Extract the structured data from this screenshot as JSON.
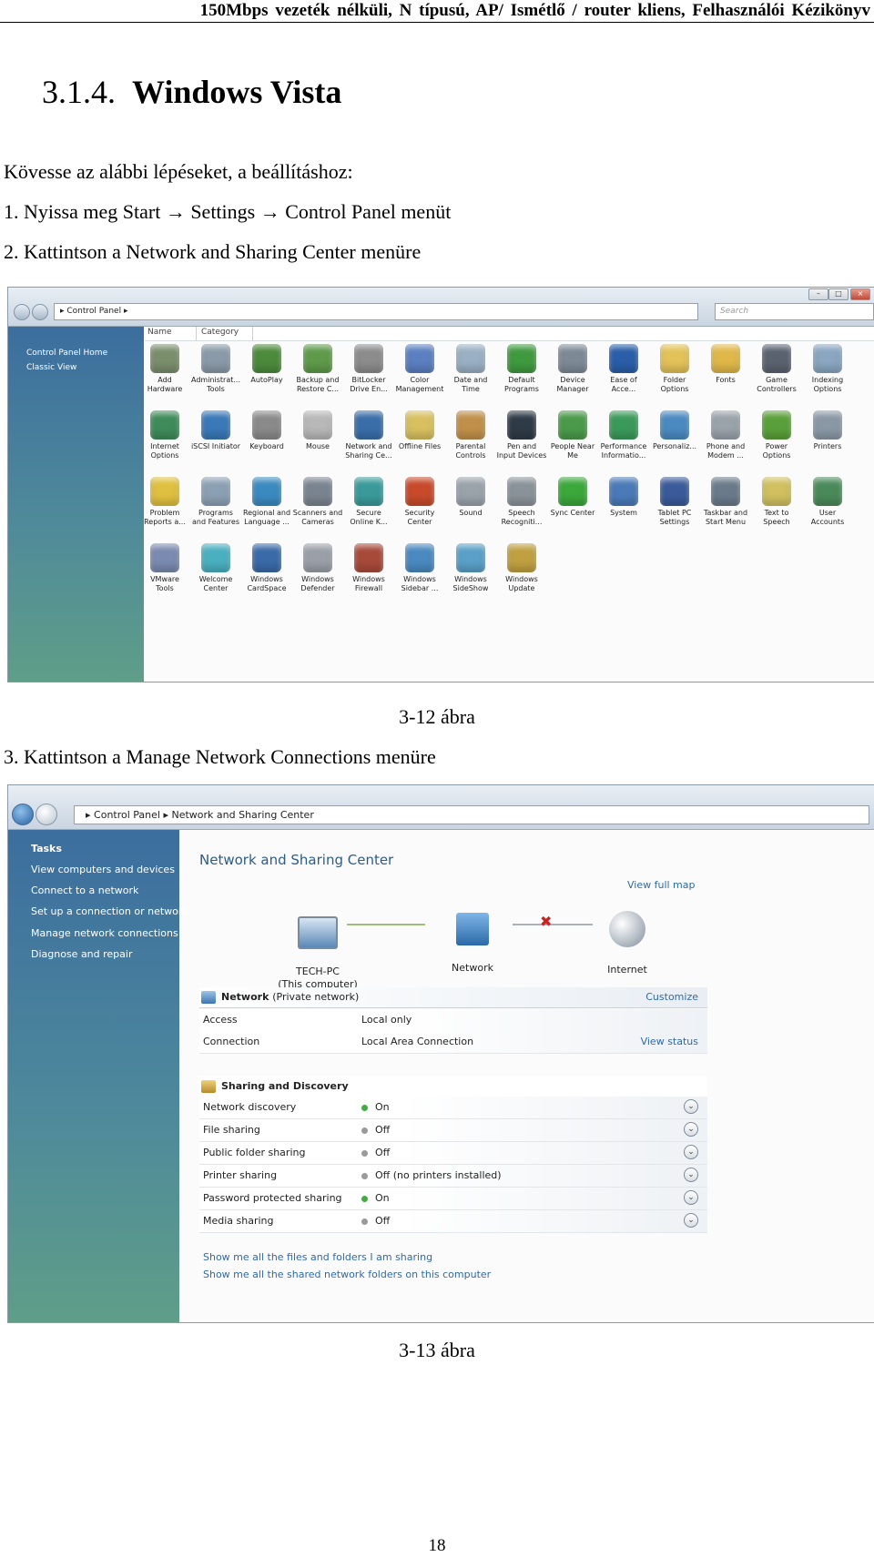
{
  "running_head": "150Mbps vezeték nélküli, N típusú, AP/ Ismétlő / router kliens, Felhasználói Kézikönyv",
  "section": {
    "number": "3.1.4.",
    "title": "Windows Vista"
  },
  "intro": "Kövesse az alábbi lépéseket, a beállításhoz:",
  "step1": "1. Nyissa meg Start → Settings → Control Panel menüt",
  "step2": "2. Kattintson a Network and Sharing Center menüre",
  "caption1": "3-12 ábra",
  "step3": "3. Kattintson a Manage Network Connections menüre",
  "caption2": "3-13 ábra",
  "page_number": "18",
  "control_panel": {
    "address": "Control Panel",
    "search_placeholder": "Search",
    "sidebar": [
      "Control Panel Home",
      "Classic View"
    ],
    "columns": [
      "Name",
      "Category"
    ],
    "items": [
      {
        "label": "Add\nHardware",
        "color": "#7a8e6c"
      },
      {
        "label": "Administrat...\nTools",
        "color": "#8a9aa8"
      },
      {
        "label": "AutoPlay",
        "color": "#4c8a3c"
      },
      {
        "label": "Backup and\nRestore C...",
        "color": "#5f9a4a"
      },
      {
        "label": "BitLocker\nDrive En...",
        "color": "#8c8c8c"
      },
      {
        "label": "Color\nManagement",
        "color": "#5b7fc0"
      },
      {
        "label": "Date and\nTime",
        "color": "#9ab0c4"
      },
      {
        "label": "Default\nPrograms",
        "color": "#3f9a3f"
      },
      {
        "label": "Device\nManager",
        "color": "#7d8a96"
      },
      {
        "label": "Ease of\nAcce...",
        "color": "#2a5ea8"
      },
      {
        "label": "Folder\nOptions",
        "color": "#e3c25a"
      },
      {
        "label": "Fonts",
        "color": "#e0b84a"
      },
      {
        "label": "Game\nControllers",
        "color": "#5a6270"
      },
      {
        "label": "Indexing\nOptions",
        "color": "#8aa6c0"
      },
      {
        "label": "Internet\nOptions",
        "color": "#3f8c5a"
      },
      {
        "label": "iSCSI Initiator",
        "color": "#3a78b8"
      },
      {
        "label": "Keyboard",
        "color": "#8a8a8a"
      },
      {
        "label": "Mouse",
        "color": "#b8b8b8"
      },
      {
        "label": "Network and\nSharing Ce...",
        "color": "#3a6ea8"
      },
      {
        "label": "Offline Files",
        "color": "#d8c060"
      },
      {
        "label": "Parental\nControls",
        "color": "#c0904a"
      },
      {
        "label": "Pen and\nInput Devices",
        "color": "#2e3a46"
      },
      {
        "label": "People Near\nMe",
        "color": "#4a9a4a"
      },
      {
        "label": "Performance\nInformatio...",
        "color": "#3a9a5a"
      },
      {
        "label": "Personaliz...",
        "color": "#4a8ac0"
      },
      {
        "label": "Phone and\nModem ...",
        "color": "#9aa2aa"
      },
      {
        "label": "Power\nOptions",
        "color": "#5aa03a"
      },
      {
        "label": "Printers",
        "color": "#8a98a6"
      },
      {
        "label": "Problem\nReports a...",
        "color": "#e0c040"
      },
      {
        "label": "Programs\nand Features",
        "color": "#8ca0b4"
      },
      {
        "label": "Regional and\nLanguage ...",
        "color": "#3a8ac0"
      },
      {
        "label": "Scanners and\nCameras",
        "color": "#7a8490"
      },
      {
        "label": "Secure\nOnline K...",
        "color": "#3a9a9a"
      },
      {
        "label": "Security\nCenter",
        "color": "#c84a2a"
      },
      {
        "label": "Sound",
        "color": "#9aa2aa"
      },
      {
        "label": "Speech\nRecogniti...",
        "color": "#8a929a"
      },
      {
        "label": "Sync Center",
        "color": "#3aa83a"
      },
      {
        "label": "System",
        "color": "#4a7ab8"
      },
      {
        "label": "Tablet PC\nSettings",
        "color": "#3a5a9a"
      },
      {
        "label": "Taskbar and\nStart Menu",
        "color": "#6a7a8a"
      },
      {
        "label": "Text to\nSpeech",
        "color": "#d0c060"
      },
      {
        "label": "User\nAccounts",
        "color": "#4a8a5a"
      },
      {
        "label": "VMware\nTools",
        "color": "#7a8ab0"
      },
      {
        "label": "Welcome\nCenter",
        "color": "#4ab0c0"
      },
      {
        "label": "Windows\nCardSpace",
        "color": "#3a6aa8"
      },
      {
        "label": "Windows\nDefender",
        "color": "#9aa0a8"
      },
      {
        "label": "Windows\nFirewall",
        "color": "#a84a3a"
      },
      {
        "label": "Windows\nSidebar ...",
        "color": "#4a8ac0"
      },
      {
        "label": "Windows\nSideShow",
        "color": "#5aa0c8"
      },
      {
        "label": "Windows\nUpdate",
        "color": "#c0a040"
      }
    ]
  },
  "nsc": {
    "breadcrumb": [
      "Control Panel",
      "Network and Sharing Center"
    ],
    "tasks_heading": "Tasks",
    "tasks": [
      "View computers and devices",
      "Connect to a network",
      "Set up a connection or network",
      "Manage network connections",
      "Diagnose and repair"
    ],
    "title": "Network and Sharing Center",
    "view_full_map": "View full map",
    "map": {
      "computer": "TECH-PC\n(This computer)",
      "network": "Network",
      "internet": "Internet"
    },
    "network_panel": {
      "name": "Network",
      "type": "(Private network)",
      "customize": "Customize",
      "rows": [
        {
          "label": "Access",
          "value": "Local only"
        },
        {
          "label": "Connection",
          "value": "Local Area Connection",
          "action": "View status"
        }
      ]
    },
    "sharing": {
      "title": "Sharing and Discovery",
      "rows": [
        {
          "label": "Network discovery",
          "value": "On",
          "on": true
        },
        {
          "label": "File sharing",
          "value": "Off",
          "on": false
        },
        {
          "label": "Public folder sharing",
          "value": "Off",
          "on": false
        },
        {
          "label": "Printer sharing",
          "value": "Off (no printers installed)",
          "on": false
        },
        {
          "label": "Password protected sharing",
          "value": "On",
          "on": true
        },
        {
          "label": "Media sharing",
          "value": "Off",
          "on": false
        }
      ]
    },
    "links": [
      "Show me all the files and folders I am sharing",
      "Show me all the shared network folders on this computer"
    ]
  }
}
